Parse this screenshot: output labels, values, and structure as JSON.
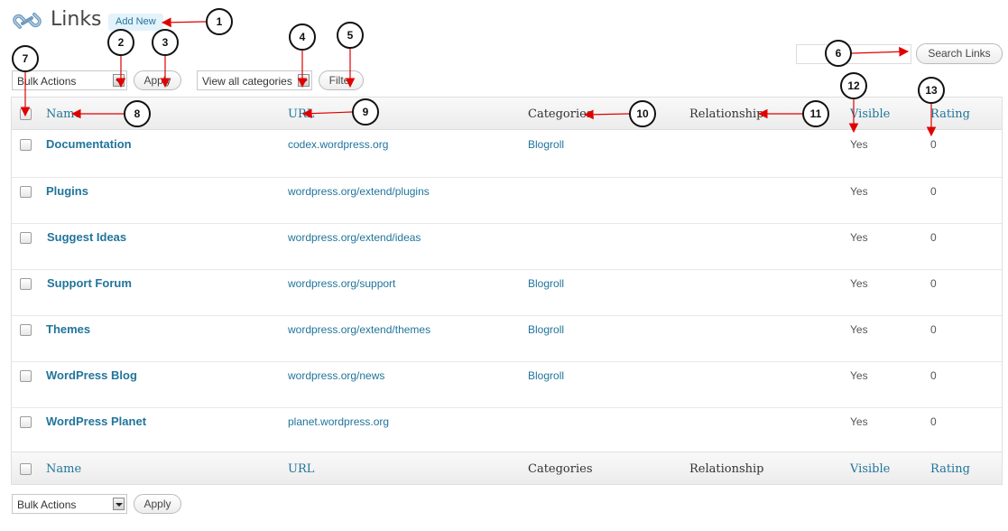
{
  "header": {
    "title": "Links",
    "add_new_label": "Add New",
    "icon": "link-icon"
  },
  "top_controls": {
    "bulk_actions_selected": "Bulk Actions",
    "apply_label": "Apply",
    "category_selected": "View all categories",
    "filter_label": "Filter",
    "search_value": "",
    "search_button_label": "Search Links"
  },
  "table": {
    "columns": {
      "name": "Name",
      "url": "URL",
      "categories": "Categories",
      "relationship": "Relationship",
      "visible": "Visible",
      "rating": "Rating"
    },
    "rows": [
      {
        "name": "Documentation",
        "url": "codex.wordpress.org",
        "categories": "Blogroll",
        "relationship": "",
        "visible": "Yes",
        "rating": "0"
      },
      {
        "name": "Plugins",
        "url": "wordpress.org/extend/plugins",
        "categories": "",
        "relationship": "",
        "visible": "Yes",
        "rating": "0"
      },
      {
        "name": "Suggest Ideas",
        "url": "wordpress.org/extend/ideas",
        "categories": "",
        "relationship": "",
        "visible": "Yes",
        "rating": "0"
      },
      {
        "name": "Support Forum",
        "url": "wordpress.org/support",
        "categories": "Blogroll",
        "relationship": "",
        "visible": "Yes",
        "rating": "0"
      },
      {
        "name": "Themes",
        "url": "wordpress.org/extend/themes",
        "categories": "Blogroll",
        "relationship": "",
        "visible": "Yes",
        "rating": "0"
      },
      {
        "name": "WordPress Blog",
        "url": "wordpress.org/news",
        "categories": "Blogroll",
        "relationship": "",
        "visible": "Yes",
        "rating": "0"
      },
      {
        "name": "WordPress Planet",
        "url": "planet.wordpress.org",
        "categories": "",
        "relationship": "",
        "visible": "Yes",
        "rating": "0"
      }
    ]
  },
  "bottom_controls": {
    "bulk_actions_selected": "Bulk Actions",
    "apply_label": "Apply"
  },
  "callouts": [
    "1",
    "2",
    "3",
    "4",
    "5",
    "6",
    "7",
    "8",
    "9",
    "10",
    "11",
    "12",
    "13"
  ],
  "colors": {
    "link": "#21759b",
    "annotation_arrow": "#e00000",
    "header_bg": "#ececec",
    "add_new_bg": "#e4f2fc"
  }
}
